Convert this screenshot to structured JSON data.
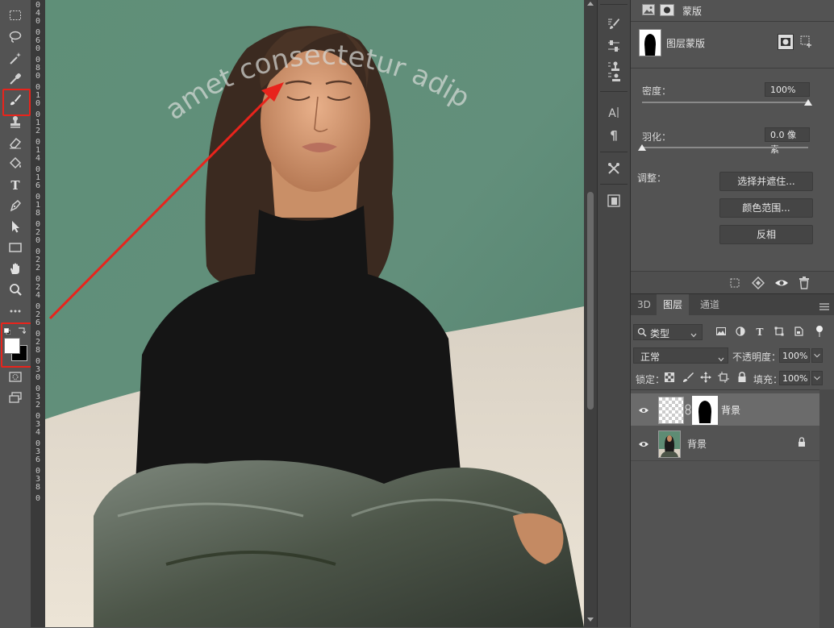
{
  "toolbar": {
    "tools": [
      "marquee-tool",
      "lasso-tool",
      "magic-wand-tool",
      "eyedropper-tool",
      "brush-tool",
      "clone-stamp-tool",
      "eraser-tool",
      "paint-bucket-tool",
      "type-tool",
      "pen-tool",
      "path-selection-tool",
      "rectangle-tool",
      "hand-tool",
      "zoom-tool",
      "more-tools"
    ],
    "active_tool": "brush-tool",
    "foreground_color": "#ffffff",
    "background_color": "#000000"
  },
  "ruler": {
    "labels": [
      "0",
      "4",
      "0",
      "0",
      "6",
      "0",
      "0",
      "8",
      "0",
      "0",
      "1",
      "0",
      "0",
      "1",
      "2",
      "0",
      "1",
      "4",
      "0",
      "1",
      "6",
      "0",
      "1",
      "8",
      "0",
      "2",
      "0",
      "0",
      "2",
      "2",
      "0",
      "2",
      "4",
      "0",
      "2",
      "6",
      "0",
      "2",
      "8",
      "0",
      "3",
      "0",
      "0",
      "3",
      "2",
      "0",
      "3",
      "4",
      "0",
      "3",
      "6",
      "0",
      "3",
      "8",
      "0"
    ]
  },
  "canvas": {
    "curved_text": "amet consectetur adipisicing sed do eiusmod",
    "annotation_color": "#e8241c"
  },
  "properties": {
    "header_tab": "蒙版",
    "mask_title": "图层蒙版",
    "density_label": "密度：",
    "density_value": "100%",
    "density_level": 1.0,
    "feather_label": "羽化：",
    "feather_value": "0.0 像素",
    "feather_level": 0.0,
    "adjust_label": "调整：",
    "select_and_mask_btn": "选择并遮住...",
    "color_range_btn": "颜色范围...",
    "invert_btn": "反相"
  },
  "layers_panel": {
    "tabs": [
      "3D",
      "图层",
      "通道"
    ],
    "active_tab": "图层",
    "filter_kind": "类型",
    "blend_mode": "正常",
    "opacity_label": "不透明度：",
    "opacity_value": "100%",
    "lock_label": "锁定：",
    "fill_label": "填充：",
    "fill_value": "100%",
    "layers": [
      {
        "name": "背景",
        "selected": true,
        "has_mask": true,
        "locked": false
      },
      {
        "name": "背景",
        "selected": false,
        "has_mask": false,
        "locked": true
      }
    ]
  }
}
